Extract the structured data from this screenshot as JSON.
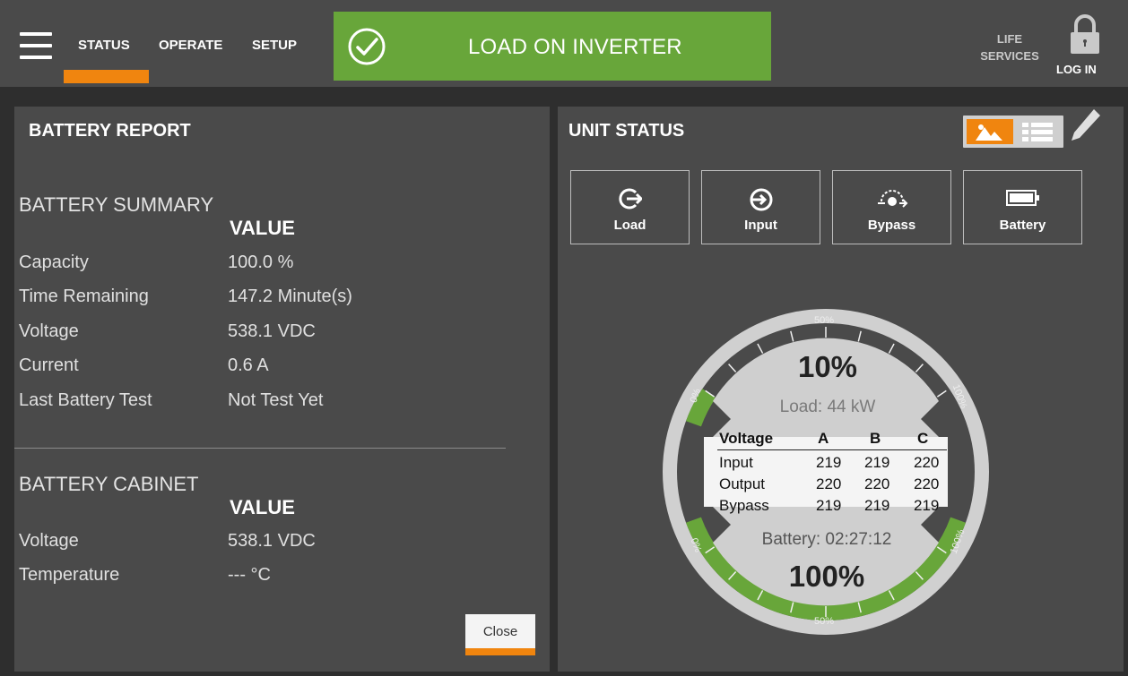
{
  "nav": {
    "tabs": [
      "STATUS",
      "OPERATE",
      "SETUP"
    ],
    "active_tab": "STATUS",
    "status_text": "LOAD ON INVERTER",
    "life_services_line1": "LIFE",
    "life_services_line2": "SERVICES",
    "login": "LOG IN",
    "accent_color": "#f0850f",
    "status_color": "#68a63a"
  },
  "battery_report": {
    "title": "BATTERY REPORT",
    "summary": {
      "title": "BATTERY SUMMARY",
      "value_header": "VALUE",
      "rows": [
        {
          "label": "Capacity",
          "value": "100.0 %"
        },
        {
          "label": "Time Remaining",
          "value": "147.2 Minute(s)"
        },
        {
          "label": "Voltage",
          "value": "538.1 VDC"
        },
        {
          "label": "Current",
          "value": "0.6 A"
        },
        {
          "label": "Last Battery Test",
          "value": "Not Test Yet"
        }
      ]
    },
    "cabinet": {
      "title": "BATTERY CABINET",
      "value_header": "VALUE",
      "rows": [
        {
          "label": "Voltage",
          "value": "538.1 VDC"
        },
        {
          "label": "Temperature",
          "value": "--- °C"
        }
      ]
    },
    "close_label": "Close"
  },
  "unit_status": {
    "title": "UNIT STATUS",
    "tiles": [
      {
        "label": "Load",
        "icon": "load-icon"
      },
      {
        "label": "Input",
        "icon": "input-icon"
      },
      {
        "label": "Bypass",
        "icon": "bypass-icon"
      },
      {
        "label": "Battery",
        "icon": "battery-icon"
      }
    ],
    "gauge": {
      "load_percent_text": "10%",
      "load_percent": 10,
      "load_text": "Load: 44 kW",
      "battery_text": "Battery: 02:27:12",
      "battery_percent_text": "100%",
      "battery_percent": 100,
      "scale_labels": {
        "zero": "0%",
        "fifty": "50%",
        "hundred": "100%"
      },
      "table": {
        "headers": [
          "Voltage",
          "A",
          "B",
          "C"
        ],
        "rows": [
          {
            "label": "Input",
            "values": [
              "219",
              "219",
              "220"
            ]
          },
          {
            "label": "Output",
            "values": [
              "220",
              "220",
              "220"
            ]
          },
          {
            "label": "Bypass",
            "values": [
              "219",
              "219",
              "219"
            ]
          }
        ]
      }
    }
  }
}
